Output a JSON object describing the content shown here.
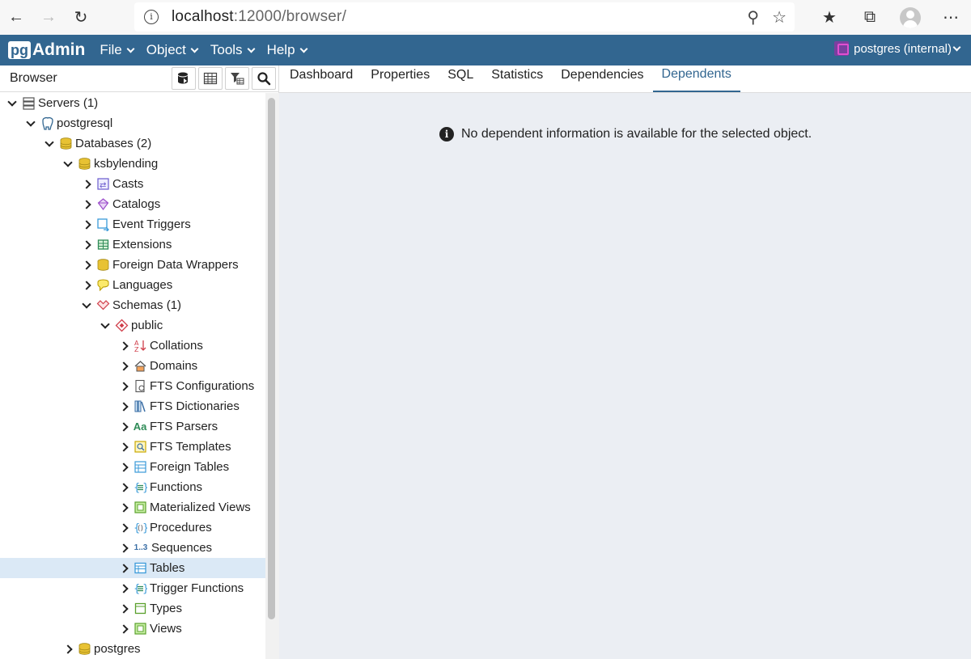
{
  "browser": {
    "url_host": "localhost",
    "url_path": ":12000/browser/"
  },
  "app": {
    "logo_prefix": "pg",
    "logo_suffix": "Admin",
    "menu": [
      "File",
      "Object",
      "Tools",
      "Help"
    ],
    "user_label": "postgres (internal)"
  },
  "panel": {
    "title": "Browser"
  },
  "tree": [
    {
      "label": "Servers (1)",
      "level": 0,
      "state": "expanded",
      "icon": "servers-icon"
    },
    {
      "label": "postgresql",
      "level": 1,
      "state": "expanded",
      "icon": "elephant-icon"
    },
    {
      "label": "Databases (2)",
      "level": 2,
      "state": "expanded",
      "icon": "databases-icon"
    },
    {
      "label": "ksbylending",
      "level": 3,
      "state": "expanded",
      "icon": "database-icon"
    },
    {
      "label": "Casts",
      "level": 4,
      "state": "collapsed",
      "icon": "casts-icon"
    },
    {
      "label": "Catalogs",
      "level": 4,
      "state": "collapsed",
      "icon": "catalogs-icon"
    },
    {
      "label": "Event Triggers",
      "level": 4,
      "state": "collapsed",
      "icon": "event-triggers-icon"
    },
    {
      "label": "Extensions",
      "level": 4,
      "state": "collapsed",
      "icon": "extensions-icon"
    },
    {
      "label": "Foreign Data Wrappers",
      "level": 4,
      "state": "collapsed",
      "icon": "fdw-icon"
    },
    {
      "label": "Languages",
      "level": 4,
      "state": "collapsed",
      "icon": "languages-icon"
    },
    {
      "label": "Schemas (1)",
      "level": 4,
      "state": "expanded",
      "icon": "schemas-icon"
    },
    {
      "label": "public",
      "level": 5,
      "state": "expanded",
      "icon": "schema-icon"
    },
    {
      "label": "Collations",
      "level": 6,
      "state": "collapsed",
      "icon": "collations-icon"
    },
    {
      "label": "Domains",
      "level": 6,
      "state": "collapsed",
      "icon": "domains-icon"
    },
    {
      "label": "FTS Configurations",
      "level": 6,
      "state": "collapsed",
      "icon": "fts-configurations-icon"
    },
    {
      "label": "FTS Dictionaries",
      "level": 6,
      "state": "collapsed",
      "icon": "fts-dictionaries-icon"
    },
    {
      "label": "FTS Parsers",
      "level": 6,
      "state": "collapsed",
      "icon": "fts-parsers-icon",
      "glyph": "Aa"
    },
    {
      "label": "FTS Templates",
      "level": 6,
      "state": "collapsed",
      "icon": "fts-templates-icon"
    },
    {
      "label": "Foreign Tables",
      "level": 6,
      "state": "collapsed",
      "icon": "foreign-tables-icon"
    },
    {
      "label": "Functions",
      "level": 6,
      "state": "collapsed",
      "icon": "functions-icon"
    },
    {
      "label": "Materialized Views",
      "level": 6,
      "state": "collapsed",
      "icon": "materialized-views-icon"
    },
    {
      "label": "Procedures",
      "level": 6,
      "state": "collapsed",
      "icon": "procedures-icon"
    },
    {
      "label": "Sequences",
      "level": 6,
      "state": "collapsed",
      "icon": "sequences-icon",
      "glyph": "1..3"
    },
    {
      "label": "Tables",
      "level": 6,
      "state": "collapsed",
      "icon": "tables-icon",
      "selected": true
    },
    {
      "label": "Trigger Functions",
      "level": 6,
      "state": "collapsed",
      "icon": "trigger-functions-icon"
    },
    {
      "label": "Types",
      "level": 6,
      "state": "collapsed",
      "icon": "types-icon"
    },
    {
      "label": "Views",
      "level": 6,
      "state": "collapsed",
      "icon": "views-icon"
    },
    {
      "label": "postgres",
      "level": 3,
      "state": "collapsed",
      "icon": "database-icon"
    }
  ],
  "tabs": [
    {
      "label": "Dashboard",
      "active": false
    },
    {
      "label": "Properties",
      "active": false
    },
    {
      "label": "SQL",
      "active": false
    },
    {
      "label": "Statistics",
      "active": false
    },
    {
      "label": "Dependencies",
      "active": false
    },
    {
      "label": "Dependents",
      "active": true
    }
  ],
  "message": "No dependent information is available for the selected object.",
  "colors": {
    "navbar": "#326690",
    "accent": "#326690",
    "selected_row": "#dbe9f6",
    "content_bg": "#ebeef3"
  }
}
